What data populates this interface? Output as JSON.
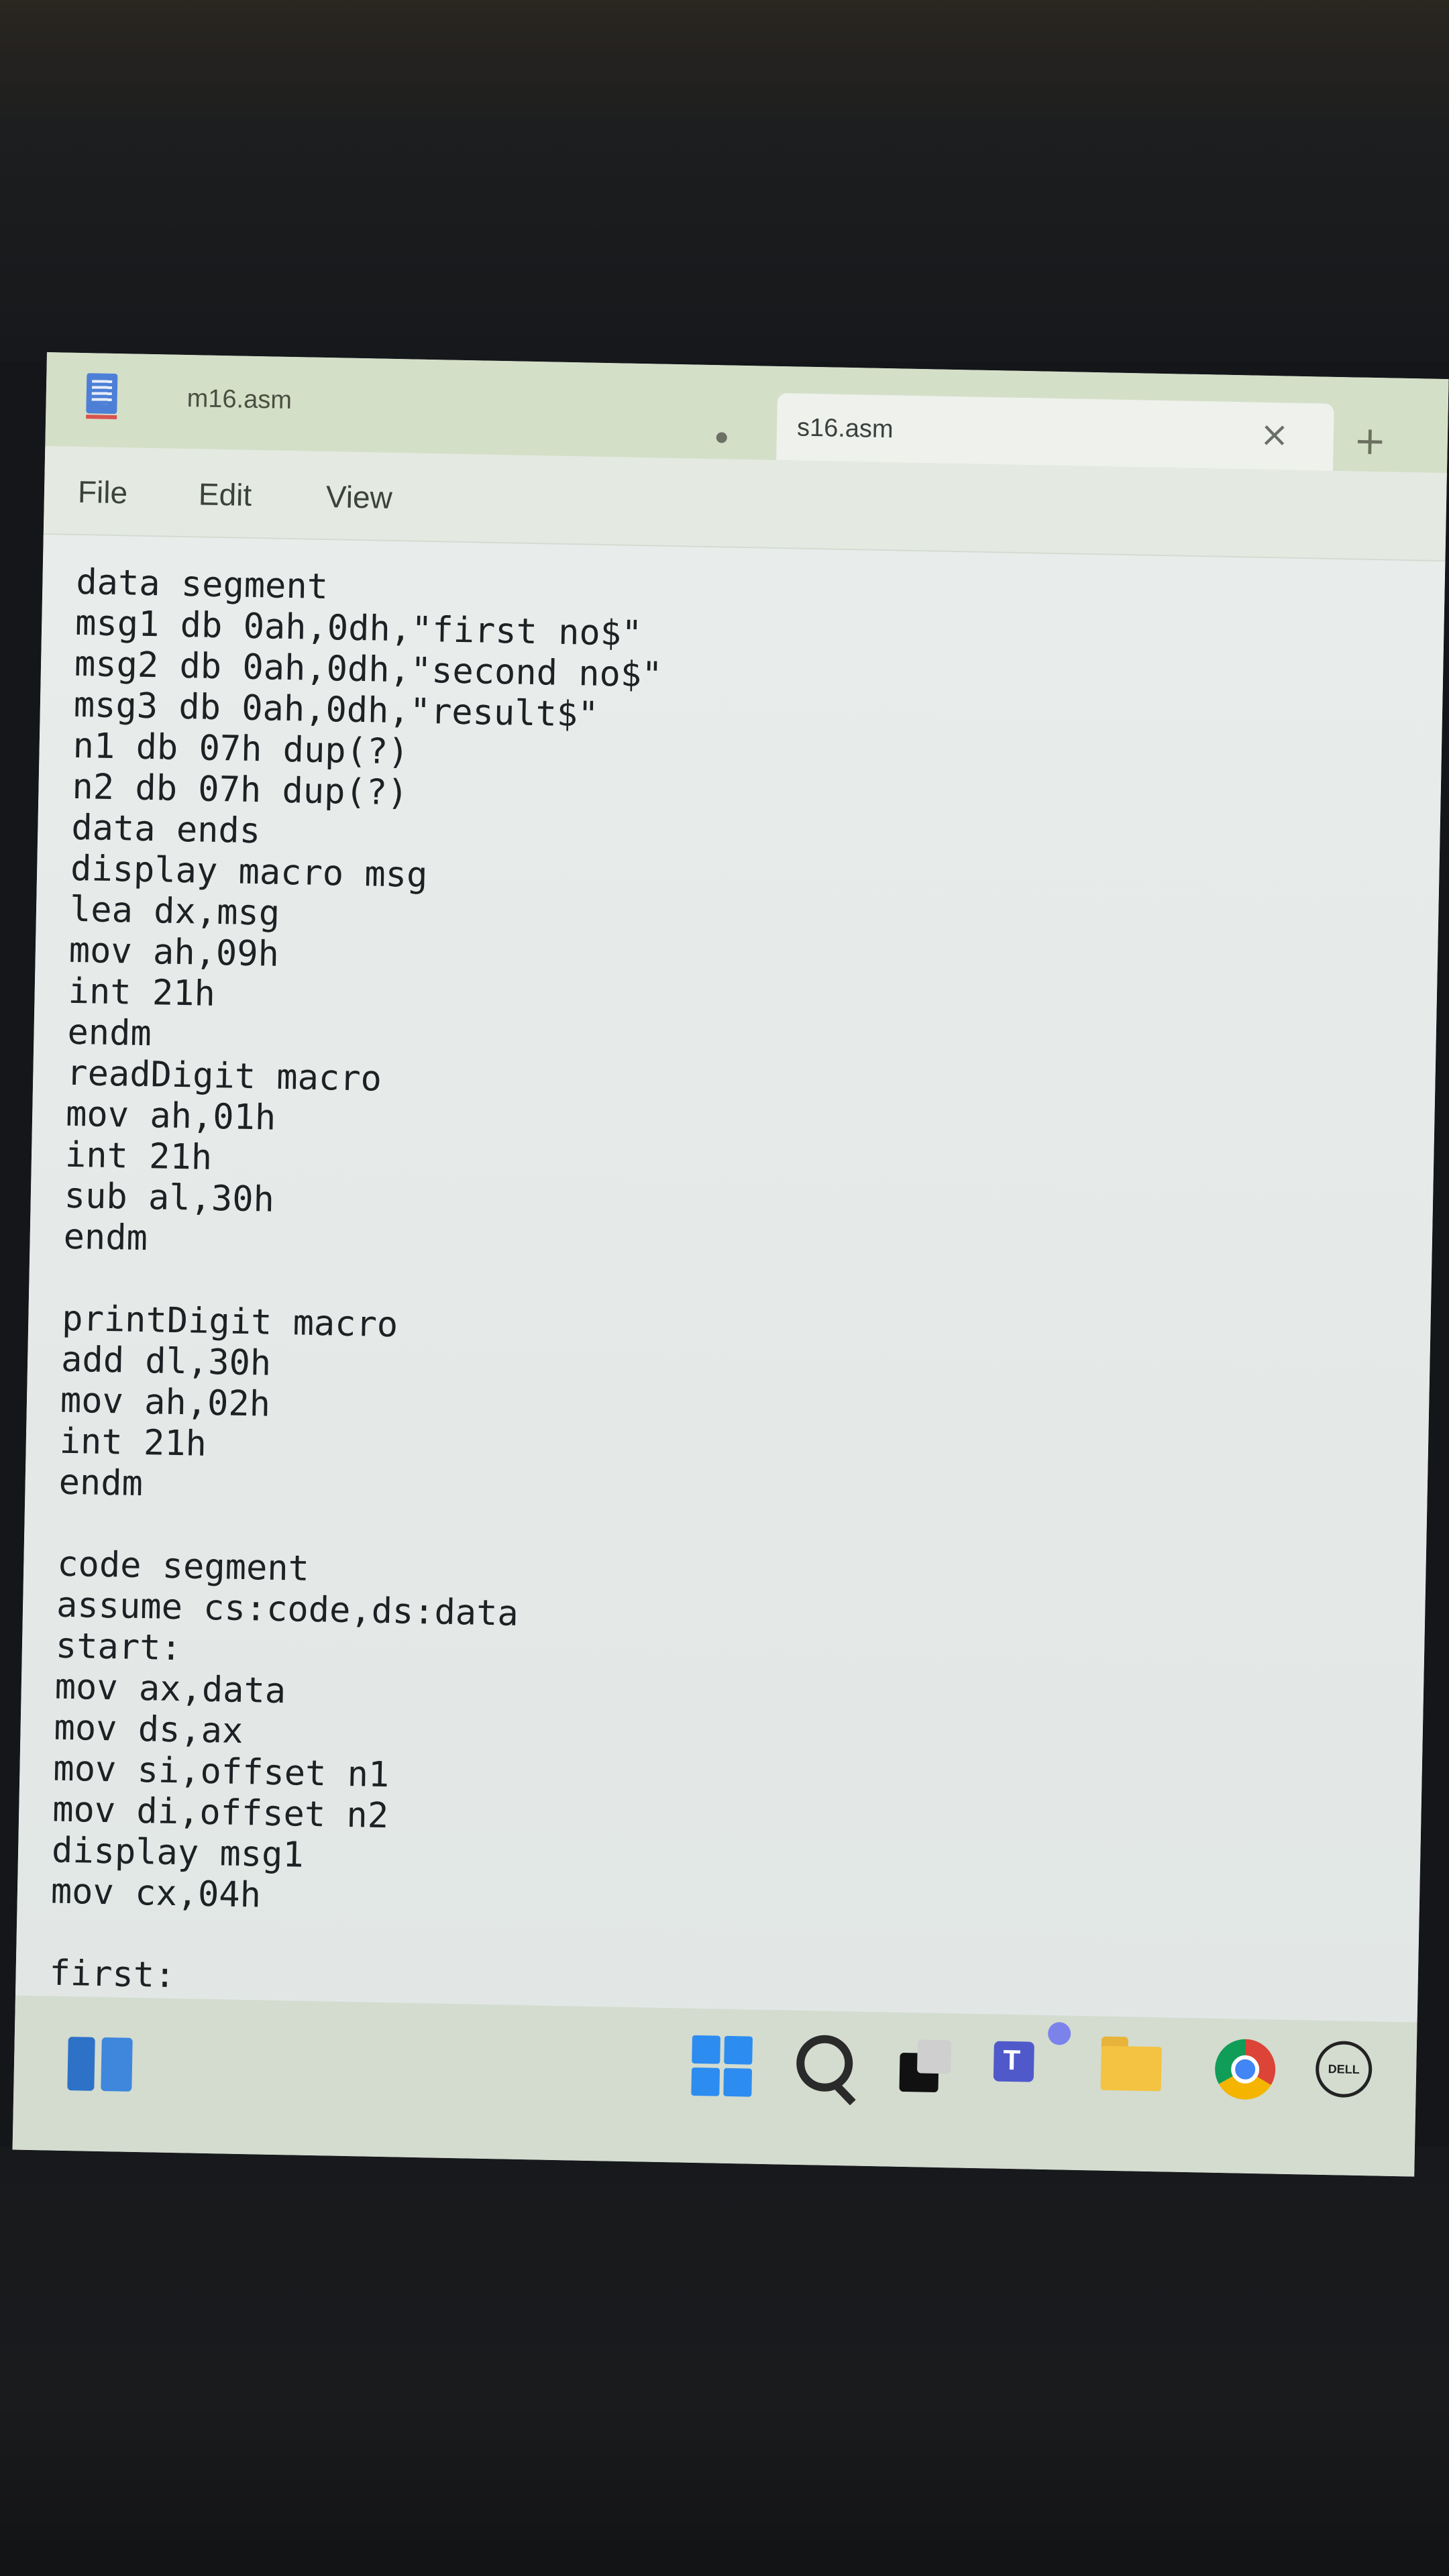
{
  "tabs": [
    {
      "title": "m16.asm",
      "active": false,
      "unsaved": true
    },
    {
      "title": "s16.asm",
      "active": true
    }
  ],
  "new_tab_symbol": "+",
  "close_symbol": "×",
  "menu": {
    "file": "File",
    "edit": "Edit",
    "view": "View"
  },
  "editor": {
    "lines": [
      "data segment",
      "msg1 db 0ah,0dh,\"first no$\"",
      "msg2 db 0ah,0dh,\"second no$\"",
      "msg3 db 0ah,0dh,\"result$\"",
      "n1 db 07h dup(?)",
      "n2 db 07h dup(?)",
      "data ends",
      "display macro msg",
      "lea dx,msg",
      "mov ah,09h",
      "int 21h",
      "endm",
      "readDigit macro",
      "mov ah,01h",
      "int 21h",
      "sub al,30h",
      "endm",
      "",
      "printDigit macro",
      "add dl,30h",
      "mov ah,02h",
      "int 21h",
      "endm",
      "",
      "code segment",
      "assume cs:code,ds:data",
      "start:",
      "mov ax,data",
      "mov ds,ax",
      "mov si,offset n1",
      "mov di,offset n2",
      "display msg1",
      "mov cx,04h",
      "",
      "first:"
    ]
  },
  "taskbar": {
    "icons": [
      "widgets-icon",
      "start-icon",
      "search-icon",
      "task-view-icon",
      "teams-icon",
      "file-explorer-icon",
      "chrome-icon",
      "dell-icon"
    ],
    "dell_text": "DELL"
  },
  "colors": {
    "tab_strip": "#d4dfc8",
    "editor_bg": "#e7ebe9",
    "taskbar": "#d3dccf",
    "text": "#1e2124"
  }
}
